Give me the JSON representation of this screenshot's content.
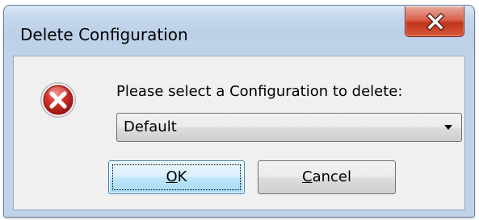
{
  "window": {
    "title": "Delete Configuration",
    "close_symbol": "✕"
  },
  "icon": "error-icon",
  "prompt": "Please select a Configuration to delete:",
  "configuration_select": {
    "selected": "Default"
  },
  "buttons": {
    "ok": {
      "label_first": "O",
      "label_rest": "K"
    },
    "cancel": {
      "label_first": "C",
      "label_rest": "ancel"
    }
  },
  "colors": {
    "error_red": "#d2342a",
    "close_red": "#c2351c",
    "title_bar_blue": "#c6d8ec",
    "default_button_blue": "#3c7fb1"
  }
}
